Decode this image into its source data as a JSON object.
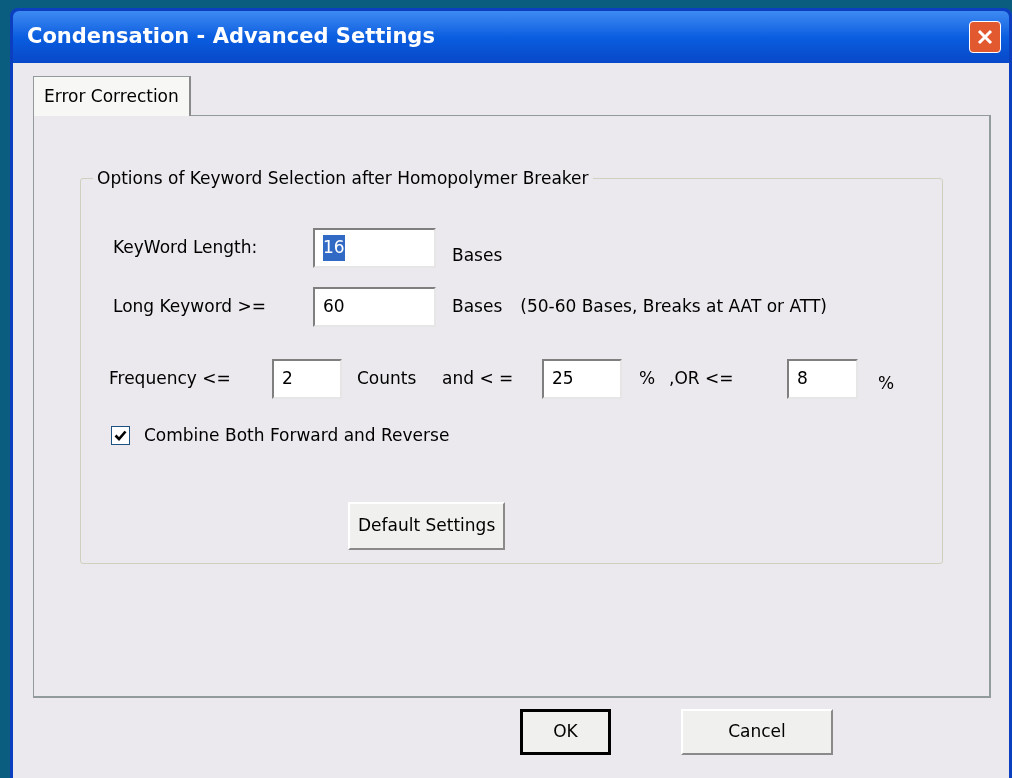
{
  "window": {
    "title": "Condensation - Advanced Settings"
  },
  "tabs": [
    {
      "label": "Error Correction",
      "selected": true
    }
  ],
  "group": {
    "title": "Options of Keyword Selection after Homopolymer Breaker"
  },
  "keyword_length": {
    "label": "KeyWord Length:",
    "value": "16",
    "value_selected": true,
    "unit": "Bases"
  },
  "long_keyword": {
    "label": "Long Keyword >=",
    "value": "60",
    "value_selected": false,
    "unit": "Bases",
    "note": "(50-60 Bases, Breaks at AAT or ATT)"
  },
  "frequency": {
    "label": "Frequency <=",
    "count_value": "2",
    "count_unit": "Counts",
    "and_label": "and < =",
    "percent_value": "25",
    "percent_unit": "%",
    "or_label": ",OR <=",
    "or_value": "8",
    "or_unit": "%"
  },
  "checkbox": {
    "label": "Combine Both Forward and Reverse",
    "checked": true
  },
  "default_button": {
    "label": "Default Settings"
  },
  "buttons": [
    {
      "label": "OK",
      "default": true
    },
    {
      "label": "Cancel",
      "default": false
    }
  ]
}
